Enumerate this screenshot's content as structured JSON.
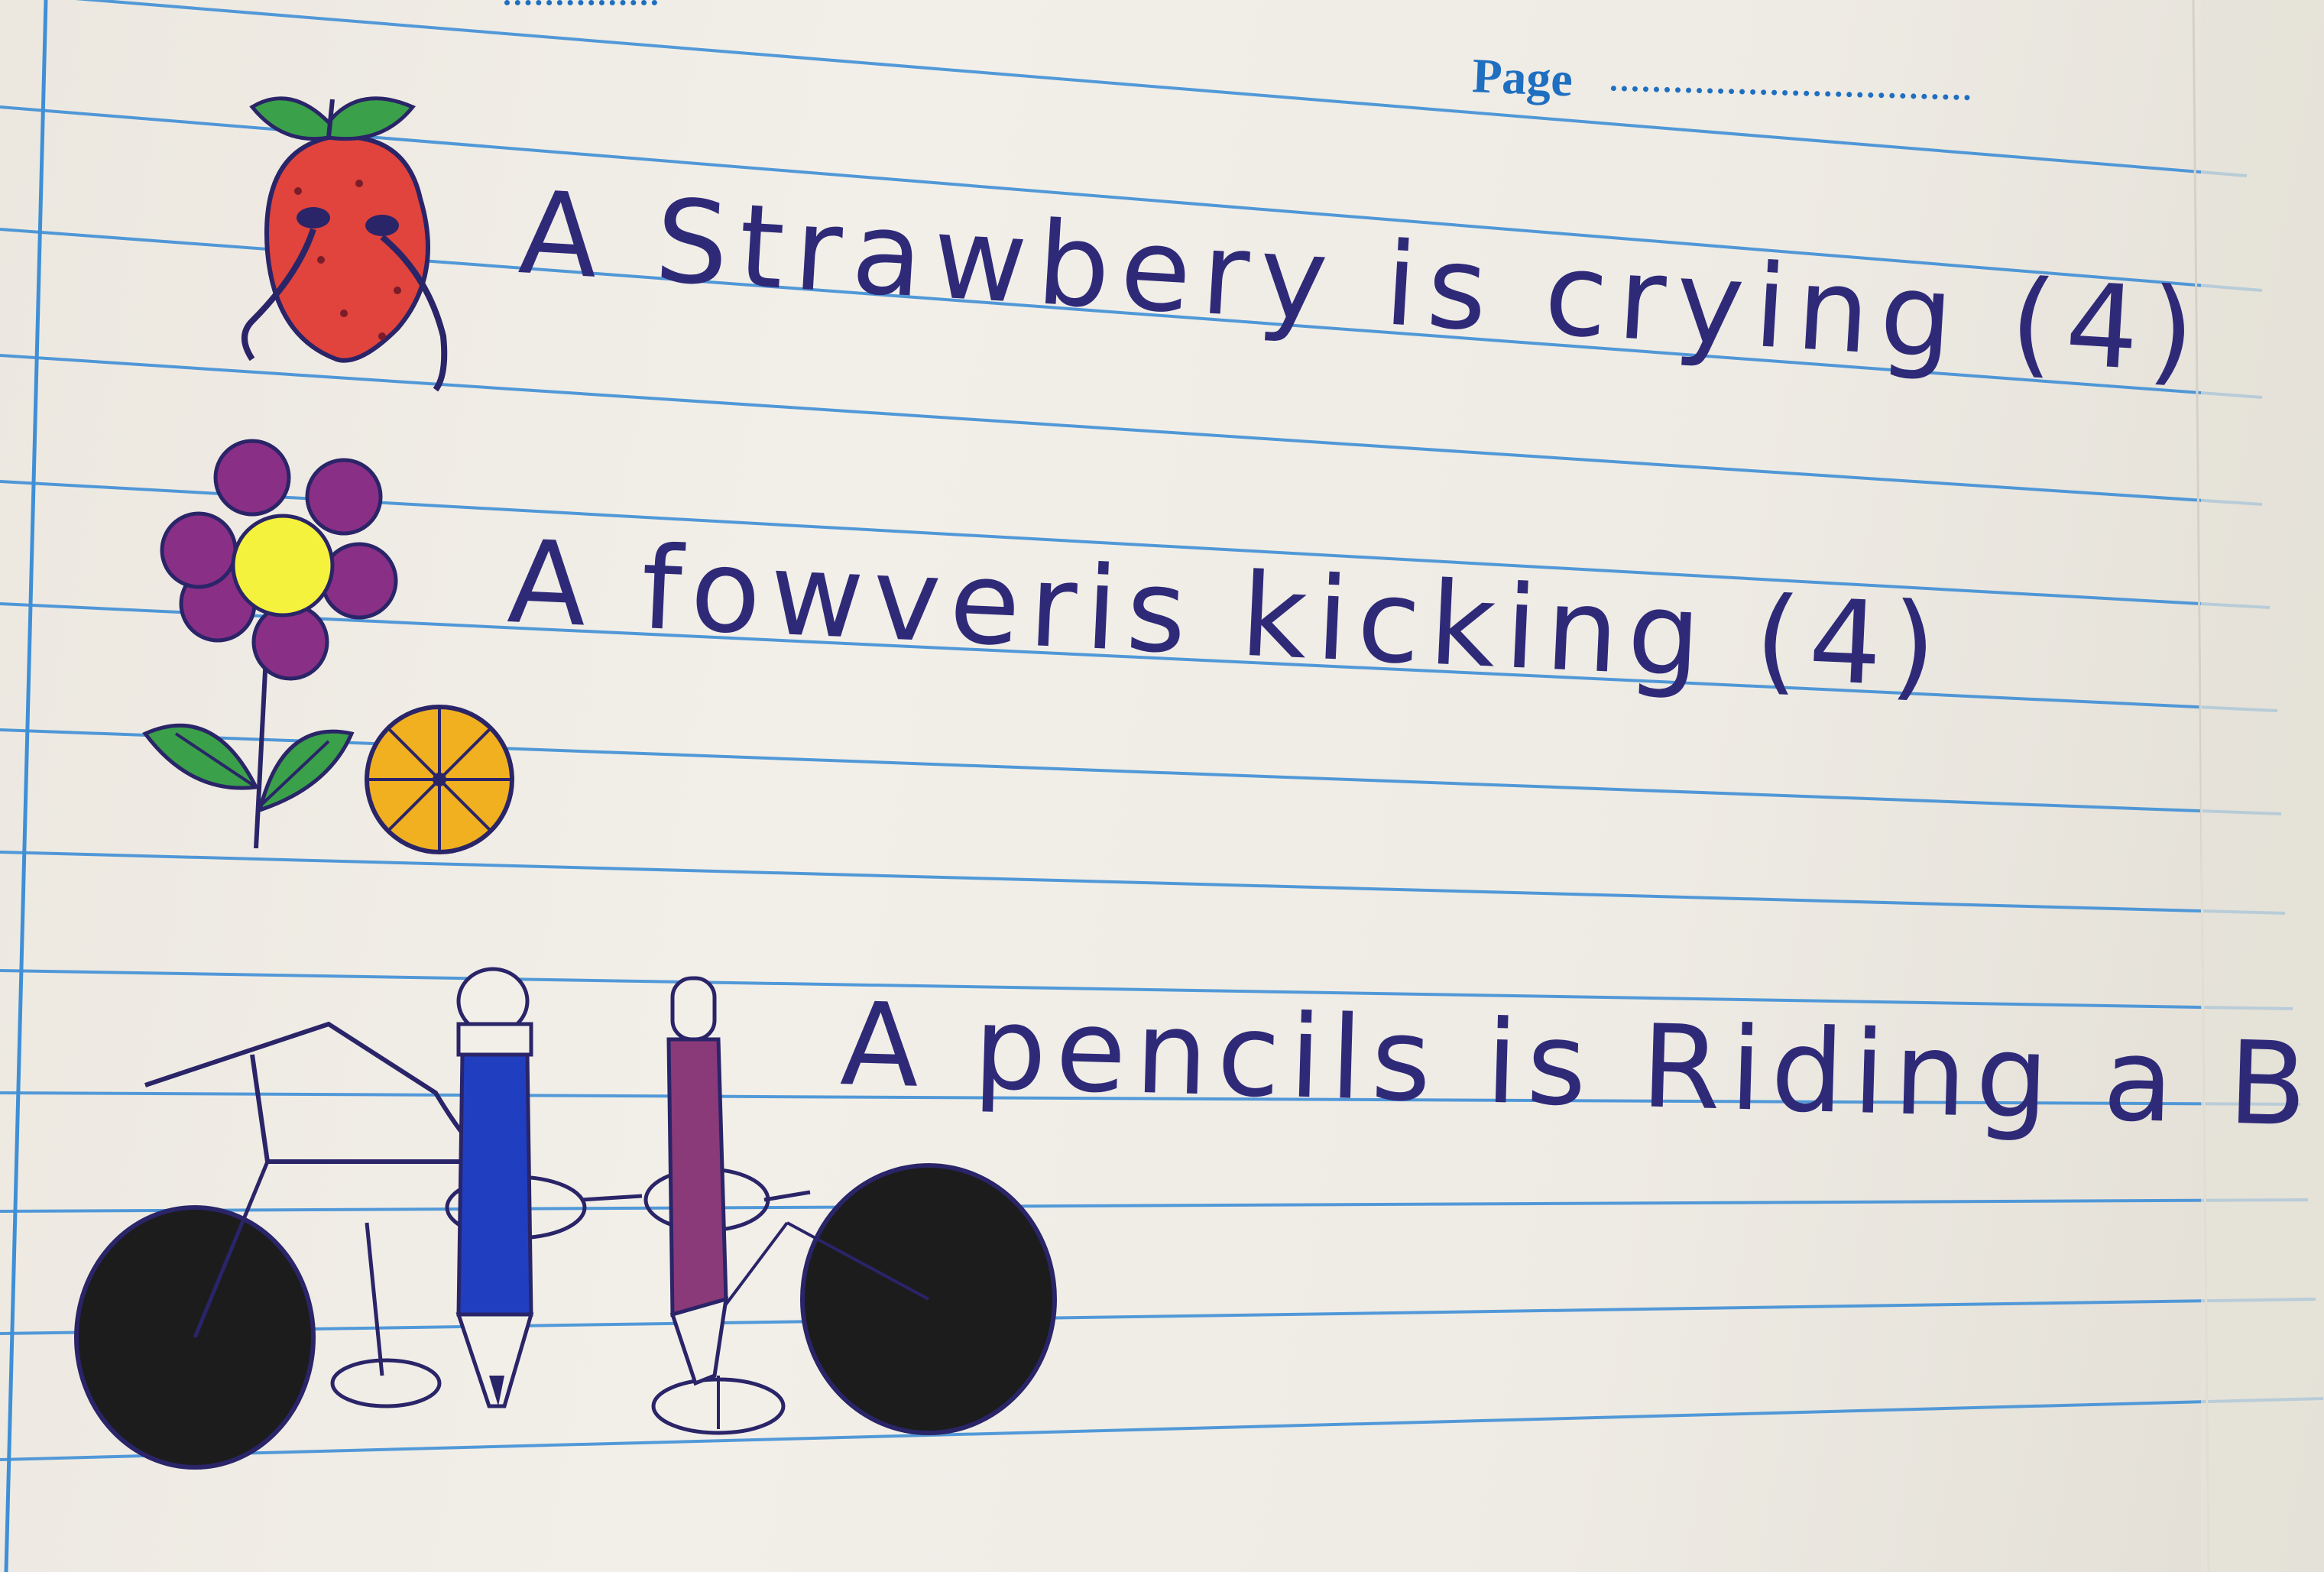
{
  "header": {
    "page_label": "Page"
  },
  "sentences": [
    {
      "text": "A Strawbery is crying (4)"
    },
    {
      "text": "A fowveris kicking (4)"
    },
    {
      "text": "A pencils is Riding a Bike"
    }
  ],
  "drawings": {
    "strawberry": {
      "icon": "crying-strawberry-drawing",
      "colors": {
        "body": "#e0443c",
        "leaf": "#3aa04a",
        "outline": "#2a2468"
      }
    },
    "flower": {
      "icon": "flower-drawing",
      "colors": {
        "petal": "#8a2f86",
        "center": "#f4f23c",
        "leaf": "#3aa04a"
      }
    },
    "ball": {
      "icon": "ball-drawing",
      "colors": {
        "fill": "#f0b020"
      }
    },
    "bike": {
      "icon": "bicycle-drawing",
      "colors": {
        "wheel": "#1c1c1c"
      }
    },
    "pencils": {
      "icon": "pencil-drawing",
      "colors": {
        "blue": "#1f3fc0",
        "purple": "#8a3a78"
      }
    }
  },
  "colors": {
    "paper": "#f0ede6",
    "rule_line": "#3f8fd6",
    "ink": "#2f2a78",
    "header_ink": "#1f6fc1"
  }
}
